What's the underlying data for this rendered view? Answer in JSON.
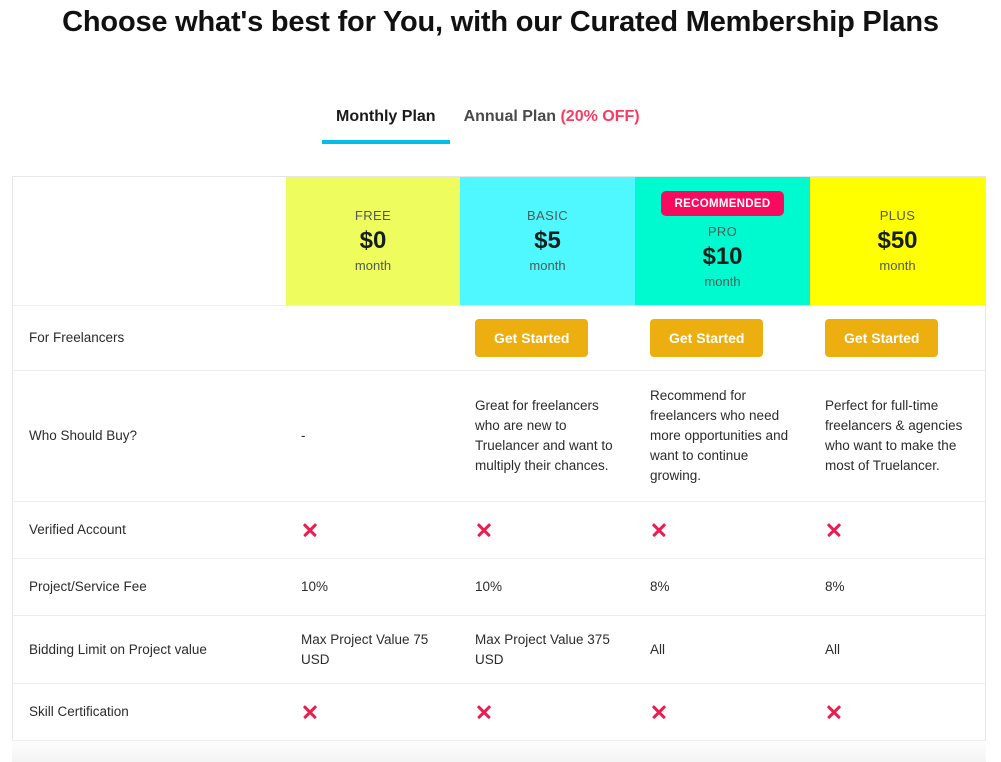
{
  "header": {
    "title": "Choose what's best for You, with our Curated Membership Plans"
  },
  "tabs": [
    {
      "label": "Monthly Plan",
      "discount": "",
      "active": true
    },
    {
      "label": "Annual Plan",
      "discount": "(20% OFF)",
      "active": false
    }
  ],
  "plans": [
    {
      "key": "free",
      "name": "FREE",
      "price": "$0",
      "period": "month",
      "badge": "",
      "color": "#EFFC5E"
    },
    {
      "key": "basic",
      "name": "BASIC",
      "price": "$5",
      "period": "month",
      "badge": "",
      "color": "#4FF8FE"
    },
    {
      "key": "pro",
      "name": "PRO",
      "price": "$10",
      "period": "month",
      "badge": "RECOMMENDED",
      "color": "#00FAD0"
    },
    {
      "key": "plus",
      "name": "PLUS",
      "price": "$50",
      "period": "month",
      "badge": "",
      "color": "#FFFF00"
    }
  ],
  "cta": {
    "row_label": "For Freelancers",
    "button_label": "Get Started",
    "free": "",
    "basic": "Get Started",
    "pro": "Get Started",
    "plus": "Get Started"
  },
  "rows": {
    "who_should_buy": {
      "label": "Who Should Buy?",
      "free": "-",
      "basic": "Great for freelancers who are new to Truelancer and want to multiply their chances.",
      "pro": "Recommend for freelancers who need more opportunities and want to continue growing.",
      "plus": "Perfect for full-time freelancers & agencies who want to make the most of Truelancer."
    },
    "verified_account": {
      "label": "Verified Account",
      "free": "cross-icon",
      "basic": "cross-icon",
      "pro": "cross-icon",
      "plus": "cross-icon"
    },
    "project_service_fee": {
      "label": "Project/Service Fee",
      "free": "10%",
      "basic": "10%",
      "pro": "8%",
      "plus": "8%"
    },
    "bidding_limit": {
      "label": "Bidding Limit on Project value",
      "free": "Max Project Value 75 USD",
      "basic": "Max Project Value 375 USD",
      "pro": "All",
      "plus": "All"
    },
    "skill_certification": {
      "label": "Skill Certification",
      "free": "cross-icon",
      "basic": "cross-icon",
      "pro": "cross-icon",
      "plus": "cross-icon"
    }
  },
  "colors": {
    "tab_underline": "#03BDE8",
    "discount_text": "#fa3b5f",
    "badge_bg": "#FA0A5F",
    "cta_button": "#EDAF10",
    "cross_mark": "#ED1C4E"
  }
}
